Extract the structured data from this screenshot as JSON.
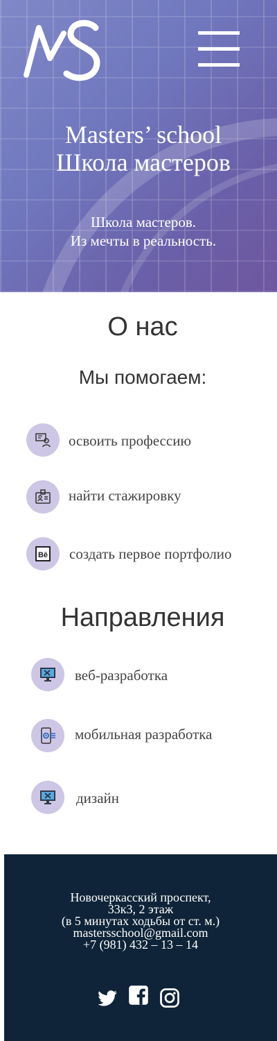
{
  "header": {
    "title_line1": "Masters’ school",
    "title_line2": "Школа мастеров",
    "subtitle_line1": "Школа мастеров.",
    "subtitle_line2": "Из мечты в реальность."
  },
  "about": {
    "title": "О нас",
    "subtitle": "Мы помогаем:",
    "items": [
      {
        "icon": "trainee-icon",
        "label": "освоить профессию"
      },
      {
        "icon": "badge-icon",
        "label": "найти стажировку"
      },
      {
        "icon": "behance-icon",
        "label": "создать первое портфолио"
      }
    ]
  },
  "directions": {
    "title": "Направления",
    "items": [
      {
        "icon": "monitor-tools-icon",
        "label": "веб-разработка"
      },
      {
        "icon": "mobile-gear-icon",
        "label": "мобильная разработка"
      },
      {
        "icon": "monitor-design-icon",
        "label": "дизайн"
      }
    ]
  },
  "footer": {
    "address_line1": "Новочеркасский проспект,",
    "address_line2": "33к3, 2 этаж",
    "address_line3": "(в 5 минутах ходьбы от ст. м.)",
    "email": "mastersschool@gmail.com",
    "phone": "+7 (981) 432 – 13 – 14",
    "social": [
      "twitter-icon",
      "facebook-icon",
      "instagram-icon"
    ]
  },
  "colors": {
    "hero": "#7077bd",
    "icon_bg": "#cdc6e4",
    "footer_bg": "#0f2438"
  }
}
